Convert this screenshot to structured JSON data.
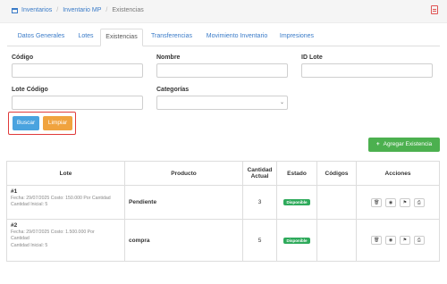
{
  "breadcrumb": {
    "home_icon": "home-icon",
    "items": [
      "Inventarios",
      "Inventario MP",
      "Existencias"
    ],
    "separator": "/"
  },
  "pdf_icon": "pdf-icon",
  "tabs": [
    {
      "label": "Datos Generales",
      "active": false
    },
    {
      "label": "Lotes",
      "active": false
    },
    {
      "label": "Existencias",
      "active": true
    },
    {
      "label": "Transferencias",
      "active": false
    },
    {
      "label": "Movimiento Inventario",
      "active": false
    },
    {
      "label": "Impresiones",
      "active": false
    }
  ],
  "filters": {
    "codigo": {
      "label": "Código",
      "value": ""
    },
    "nombre": {
      "label": "Nombre",
      "value": ""
    },
    "id_lote": {
      "label": "ID Lote",
      "value": ""
    },
    "lote_codigo": {
      "label": "Lote Código",
      "value": ""
    },
    "categorias": {
      "label": "Categorías",
      "value": ""
    }
  },
  "buttons": {
    "buscar": "Buscar",
    "limpiar": "Limpiar",
    "agregar": "Agregar Existencia",
    "agregar_symbol": "+"
  },
  "table": {
    "headers": [
      "Lote",
      "Producto",
      "Cantidad Actual",
      "Estado",
      "Códigos",
      "Acciones"
    ],
    "header_cantidad_line1": "Cantidad",
    "header_cantidad_line2": "Actual",
    "rows": [
      {
        "lote": "#1",
        "meta_line1": "Fecha: 29/07/2025 Costo: 150.000 Por Cantidad",
        "meta_line2": "Cantidad Inicial: 5",
        "producto": "Pendiente",
        "cantidad": "3",
        "estado": "Disponible",
        "codigos": ""
      },
      {
        "lote": "#2",
        "meta_line1": "Fecha: 29/07/2025 Costo: 1.500.000 Por",
        "meta_line1b": "Cantidad",
        "meta_line2": "Cantidad Inicial: 5",
        "producto": "compra",
        "cantidad": "5",
        "estado": "Disponible",
        "codigos": ""
      }
    ],
    "action_icons": [
      "trash-icon",
      "eye-icon",
      "tag-icon",
      "print-icon"
    ]
  },
  "colors": {
    "link": "#3a7bc8",
    "buscar": "#4aa3df",
    "limpiar": "#f0a33f",
    "agregar": "#4cb04f",
    "badge": "#2eaa5b",
    "highlight_outline": "#e03a3a"
  }
}
